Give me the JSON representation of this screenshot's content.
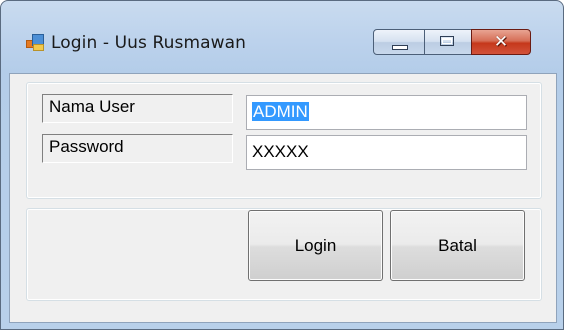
{
  "window": {
    "title": "Login - Uus Rusmawan",
    "icon": "app-form-icon",
    "controls": {
      "minimize_icon": "minimize-icon",
      "maximize_icon": "maximize-icon",
      "close_icon": "close-icon",
      "close_glyph": "✕"
    }
  },
  "form": {
    "username_label": "Nama User",
    "username_value": "ADMIN",
    "password_label": "Password",
    "password_value": "XXXXX"
  },
  "buttons": {
    "login_label": "Login",
    "cancel_label": "Batal"
  },
  "colors": {
    "selection": "#3399ff",
    "close_button": "#c5381b",
    "title_bar": "#bcd2ec"
  }
}
